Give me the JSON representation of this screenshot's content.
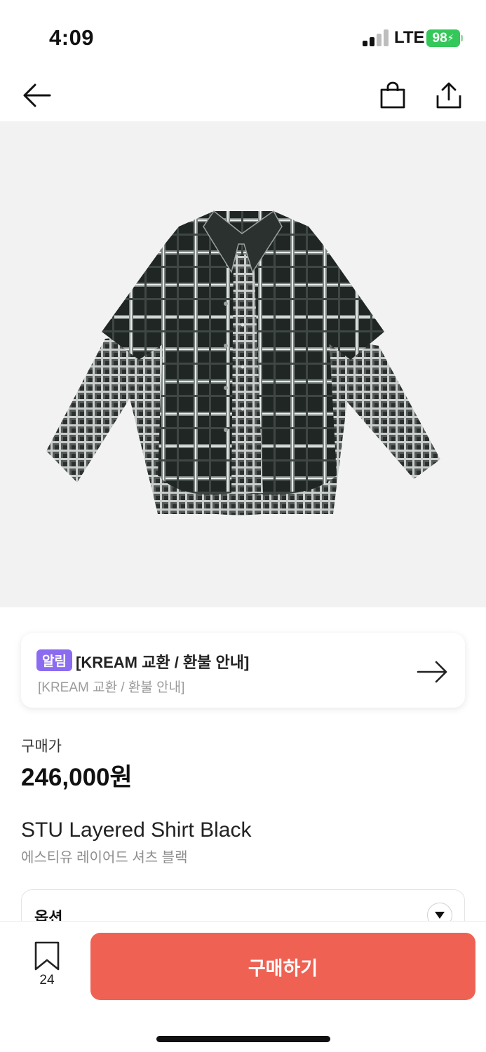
{
  "status_bar": {
    "time": "4:09",
    "network": "LTE",
    "battery": "98"
  },
  "nav": {
    "back_icon": "arrow-left-icon",
    "bag_icon": "shopping-bag-icon",
    "share_icon": "share-icon"
  },
  "product_image": {
    "icon": "plaid-layered-shirt-image"
  },
  "notice": {
    "badge": "알림",
    "title": "[KREAM 교환 / 환불 안내]",
    "subtitle": "[KREAM 교환 / 환불 안내]",
    "arrow_icon": "arrow-right-icon"
  },
  "price": {
    "label": "구매가",
    "value": "246,000원"
  },
  "product": {
    "name": "STU Layered Shirt Black",
    "name_kr": "에스티유 레이어드 셔츠 블랙"
  },
  "option": {
    "label": "옵션",
    "caret_icon": "caret-down-icon"
  },
  "bottom_bar": {
    "bookmark_icon": "bookmark-icon",
    "bookmark_count": "24",
    "buy_label": "구매하기"
  },
  "colors": {
    "buy_button": "#ef6253",
    "notice_badge": "#8b6cf0",
    "battery": "#34c759"
  }
}
